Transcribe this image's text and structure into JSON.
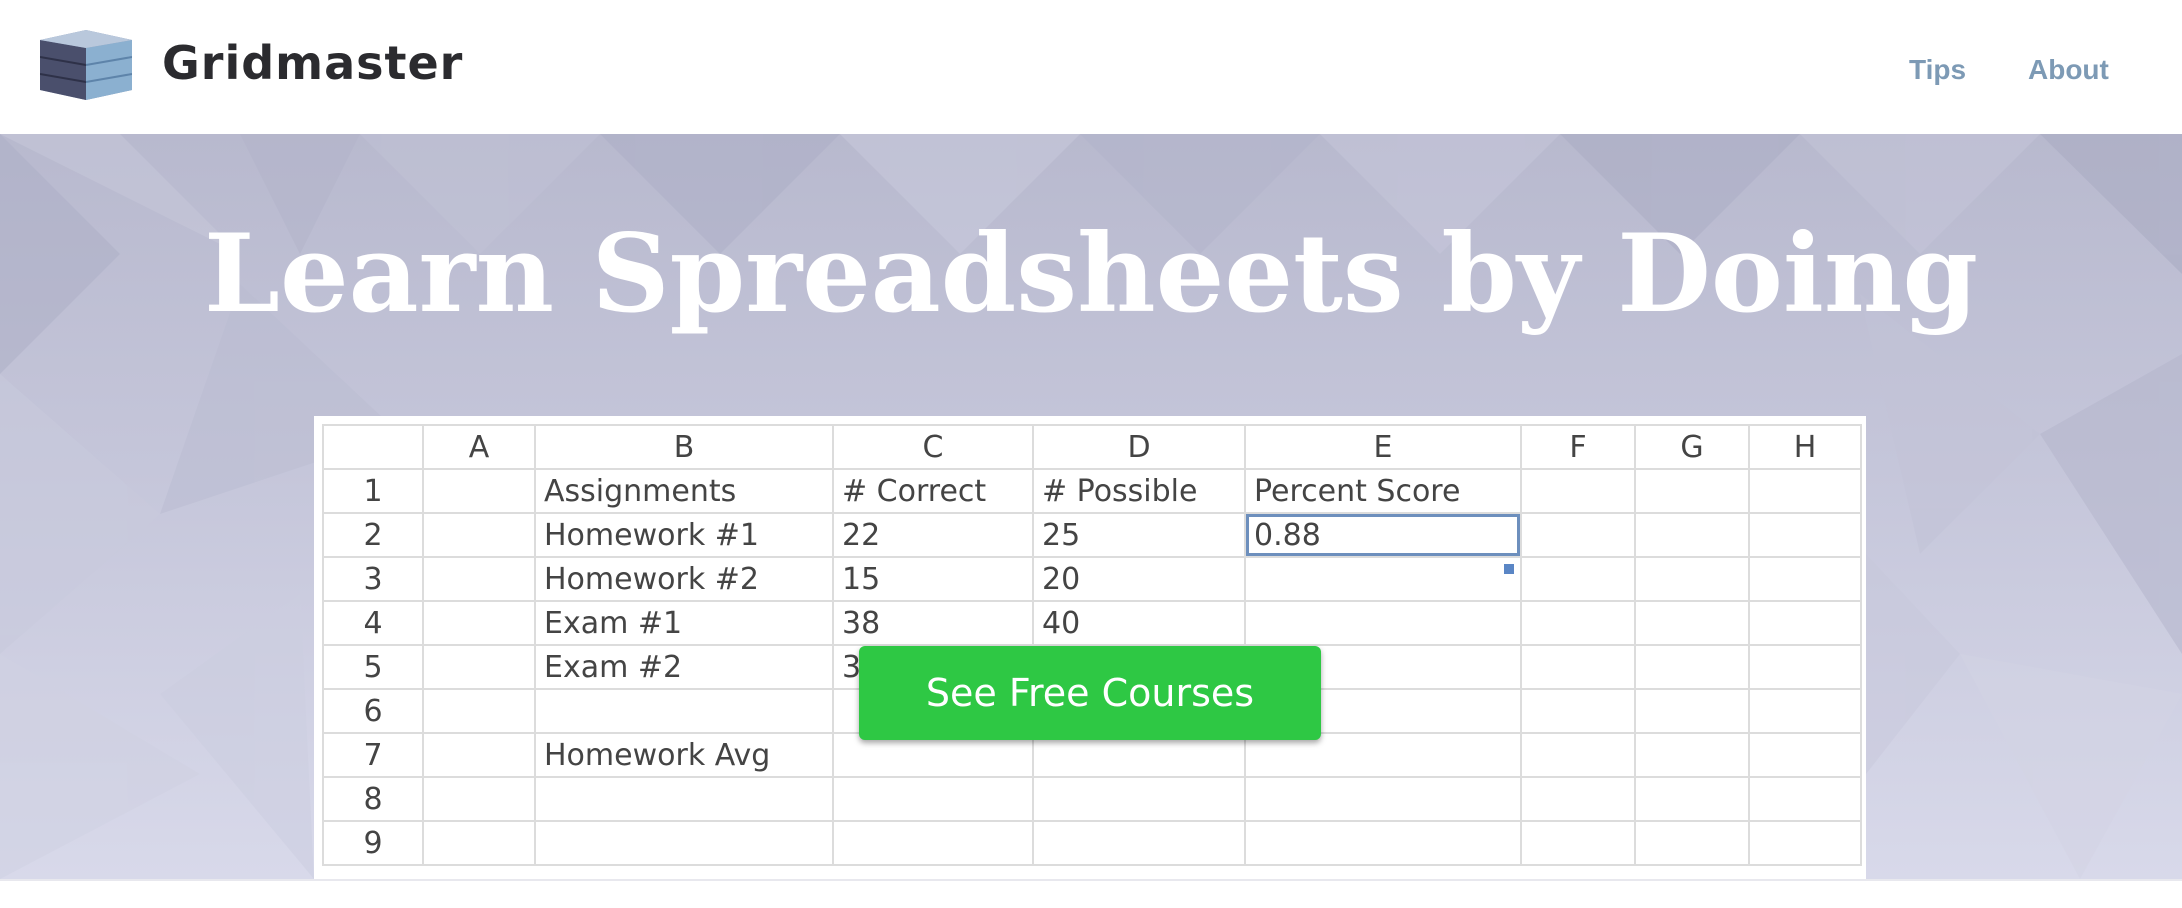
{
  "header": {
    "brand": "Gridmaster",
    "nav": [
      {
        "label": "Tips"
      },
      {
        "label": "About"
      }
    ]
  },
  "hero": {
    "title": "Learn Spreadsheets by Doing",
    "cta_label": "See Free Courses"
  },
  "sheet": {
    "columns": [
      "A",
      "B",
      "C",
      "D",
      "E",
      "F",
      "G",
      "H"
    ],
    "rows": [
      {
        "num": "1",
        "cells": [
          "",
          "Assignments",
          "# Correct",
          "# Possible",
          "Percent Score",
          "",
          "",
          ""
        ]
      },
      {
        "num": "2",
        "cells": [
          "",
          "Homework #1",
          "22",
          "25",
          "0.88",
          "",
          "",
          ""
        ]
      },
      {
        "num": "3",
        "cells": [
          "",
          "Homework #2",
          "15",
          "20",
          "",
          "",
          "",
          ""
        ]
      },
      {
        "num": "4",
        "cells": [
          "",
          "Exam #1",
          "38",
          "40",
          "",
          "",
          "",
          ""
        ]
      },
      {
        "num": "5",
        "cells": [
          "",
          "Exam #2",
          "3",
          "",
          "",
          "",
          "",
          ""
        ]
      },
      {
        "num": "6",
        "cells": [
          "",
          "",
          "",
          "",
          "",
          "",
          "",
          ""
        ]
      },
      {
        "num": "7",
        "cells": [
          "",
          "Homework Avg",
          "",
          "",
          "",
          "",
          "",
          ""
        ]
      },
      {
        "num": "8",
        "cells": [
          "",
          "",
          "",
          "",
          "",
          "",
          "",
          ""
        ]
      },
      {
        "num": "9",
        "cells": [
          "",
          "",
          "",
          "",
          "",
          "",
          "",
          ""
        ]
      }
    ],
    "selected_cell": "E2"
  },
  "colors": {
    "brand_text": "#2b2b2f",
    "nav_link": "#7d9ab5",
    "cta": "#2ec844",
    "selection": "#6d8fbd",
    "hero_bg": "#bcbdd1"
  },
  "icons": {
    "logo": "grid-cube-logo-icon"
  }
}
